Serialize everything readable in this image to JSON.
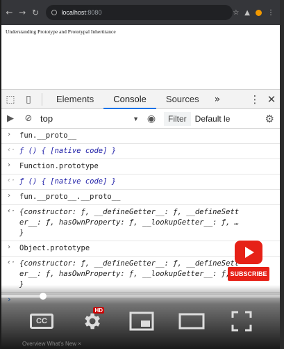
{
  "browser": {
    "url_host": "localhost",
    "url_port": ":8080"
  },
  "page": {
    "text": "Understanding Prototype and Prototypal Inhertitance"
  },
  "devtools": {
    "tabs": [
      {
        "label": "Elements"
      },
      {
        "label": "Console"
      },
      {
        "label": "Sources"
      }
    ],
    "more_tabs": "»",
    "context": "top",
    "filter_placeholder": "Filter",
    "levels": "Default le"
  },
  "console": {
    "entries": [
      {
        "input": "fun.__proto__",
        "output": [
          "ƒ () { [native code] }"
        ]
      },
      {
        "input": "Function.prototype",
        "output": [
          "ƒ () { [native code] }"
        ]
      },
      {
        "input": "fun.__proto__.__proto__",
        "output": [
          "{constructor: ƒ, __defineGetter__: ƒ, __defineSett",
          "er__: ƒ, hasOwnProperty: ƒ, __lookupGetter__: ƒ, …",
          "}"
        ]
      },
      {
        "input": "Object.prototype",
        "output": [
          "{constructor: ƒ, __defineGetter__: ƒ, __defineSett",
          "er__: ƒ, hasOwnProperty: ƒ, __lookupGetter__: ƒ, …",
          "}"
        ]
      }
    ]
  },
  "player": {
    "progress": 0.15,
    "cc_label": "CC",
    "hd_badge": "HD",
    "footer_text": "Overview  What's New  ×"
  },
  "subscribe": {
    "label": "SUBSCRIBE"
  },
  "colors": {
    "accent": "#1a73e8",
    "youtube_red": "#e62117"
  }
}
